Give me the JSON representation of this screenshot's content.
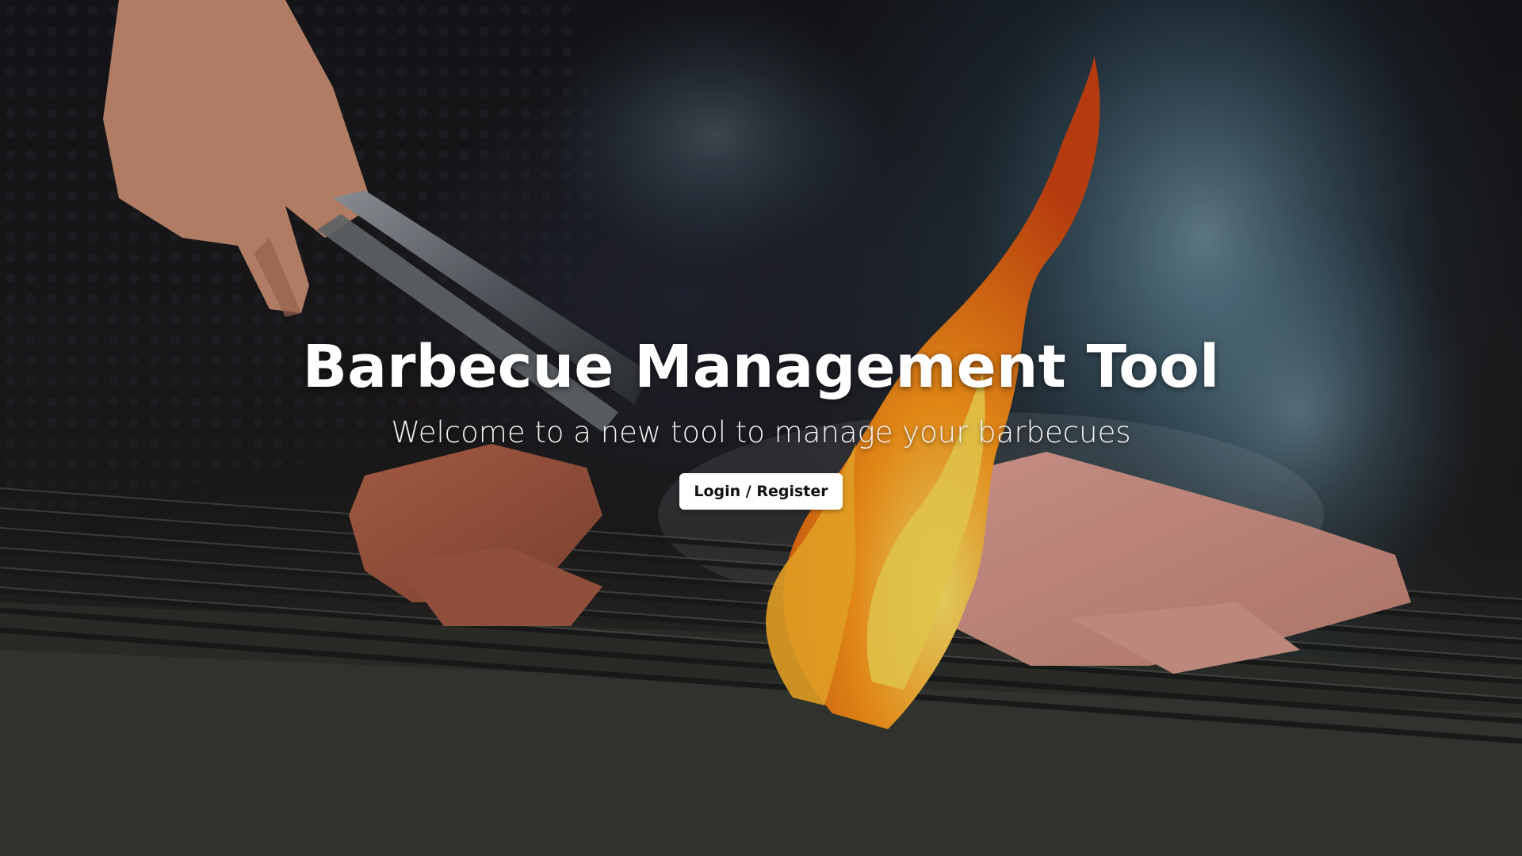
{
  "hero": {
    "background_image": "bbq-grill-flames-photo",
    "title": "Barbecue Management Tool",
    "subtitle": "Welcome to a new tool to manage your barbecues",
    "login_button_label": "Login / Register"
  },
  "colors": {
    "title_text": "#ffffff",
    "button_background": "#ffffff",
    "button_text": "#111111"
  }
}
